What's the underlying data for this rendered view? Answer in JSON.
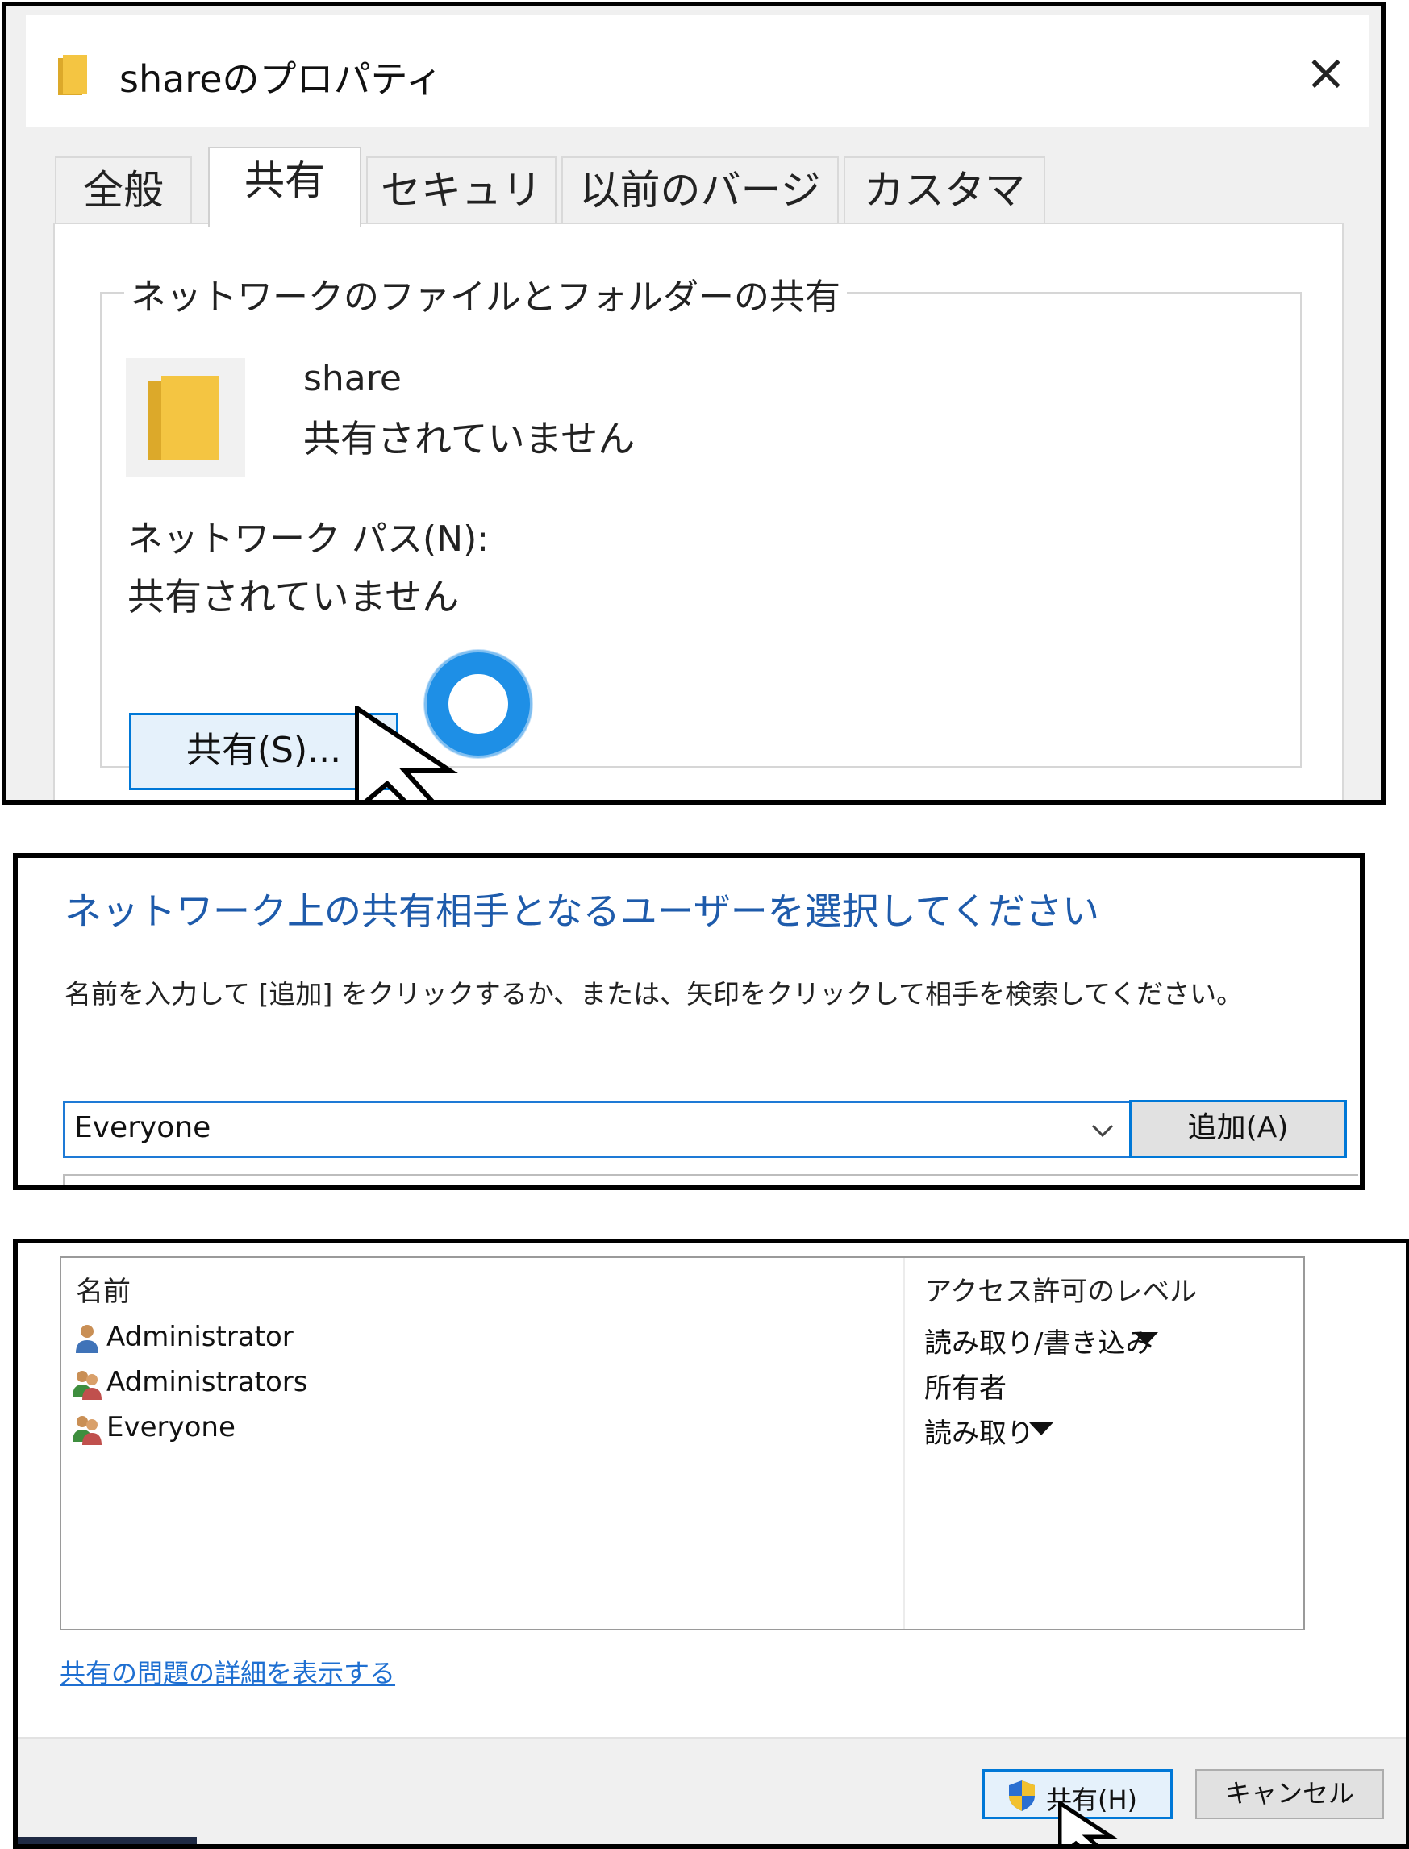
{
  "properties_dialog": {
    "title": "shareのプロパティ",
    "close_glyph": "×",
    "tabs": [
      {
        "label": "全般",
        "active": false
      },
      {
        "label": "共有",
        "active": true
      },
      {
        "label": "セキュリティ",
        "active": false
      },
      {
        "label": "以前のバージョン",
        "active": false
      },
      {
        "label": "カスタマイズ",
        "active": false
      }
    ],
    "group_title": "ネットワークのファイルとフォルダーの共有",
    "folder_name": "share",
    "share_status": "共有されていません",
    "network_path_label": "ネットワーク パス(N):",
    "network_path_value": "共有されていません",
    "share_button": "共有(S)..."
  },
  "choose_people": {
    "heading": "ネットワーク上の共有相手となるユーザーを選択してください",
    "instruction": "名前を入力して [追加] をクリックするか、または、矢印をクリックして相手を検索してください。",
    "user_input_value": "Everyone",
    "add_button": "追加(A)"
  },
  "share_list": {
    "columns": {
      "name": "名前",
      "access": "アクセス許可のレベル"
    },
    "rows": [
      {
        "name": "Administrator",
        "icon": "user-icon",
        "level": "読み取り/書き込み",
        "has_dropdown": true
      },
      {
        "name": "Administrators",
        "icon": "group-icon",
        "level": "所有者",
        "has_dropdown": false
      },
      {
        "name": "Everyone",
        "icon": "group-icon",
        "level": "読み取り",
        "has_dropdown": true
      }
    ],
    "details_link": "共有の問題の詳細を表示する",
    "share_button": "共有(H)",
    "cancel_button": "キャンセル"
  },
  "colors": {
    "accent_blue": "#0078d7",
    "heading_blue": "#1e5bab",
    "link_blue": "#1e6fd1",
    "folder_yellow": "#f4c542",
    "busy_ring": "#1e8fe6"
  }
}
